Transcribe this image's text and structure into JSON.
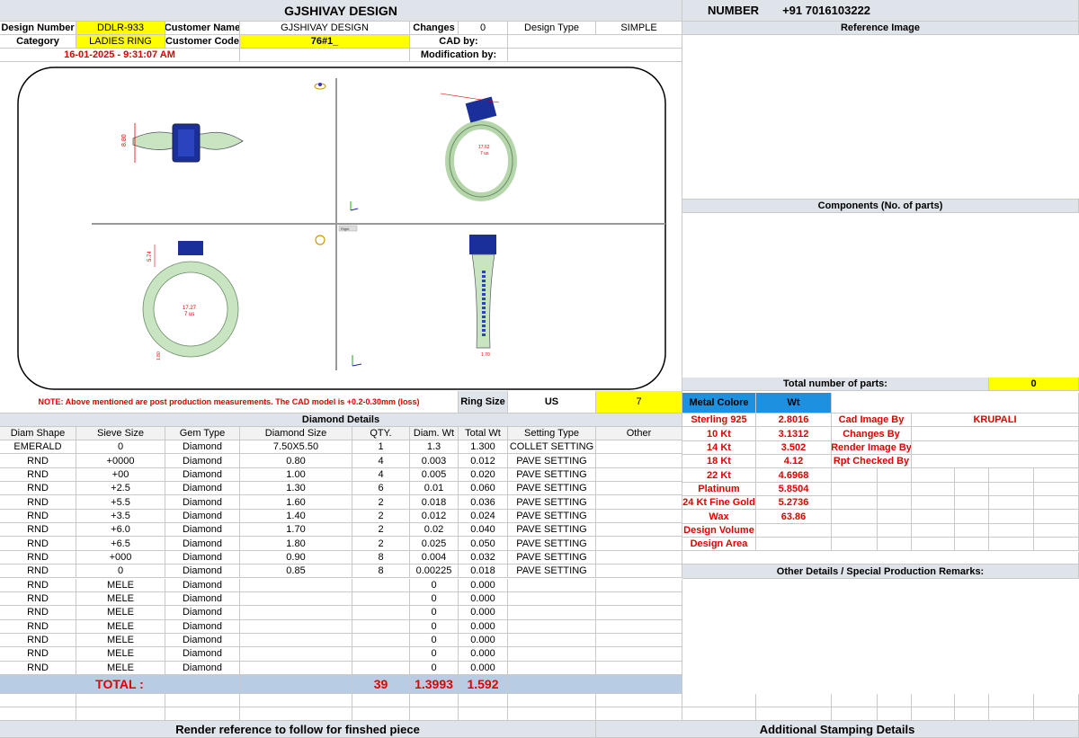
{
  "header": {
    "title": "GJSHIVAY DESIGN",
    "number_label": "NUMBER",
    "number_value": "+91 7016103222"
  },
  "info": {
    "design_number_label": "Design Number",
    "design_number": "DDLR-933",
    "customer_name_label": "Customer Name",
    "customer_name": "GJSHIVAY DESIGN",
    "changes_label": "Changes",
    "changes": "0",
    "design_type_label": "Design Type",
    "design_type": "SIMPLE",
    "category_label": "Category",
    "category": "LADIES RING",
    "customer_code_label": "Customer Code",
    "customer_code": "76#1_",
    "cad_by_label": "CAD by:",
    "timestamp": "16-01-2025 - 9:31:07 AM",
    "modification_label": "Modification by:"
  },
  "right_panel": {
    "reference_image": "Reference Image",
    "components": "Components (No. of parts)",
    "total_parts_label": "Total number of parts:",
    "total_parts": "0",
    "other_details": "Other Details / Special Production Remarks:",
    "additional_stamping": "Additional Stamping Details"
  },
  "note": {
    "text": "NOTE: Above mentioned are post production measurements. The CAD model is +0.2-0.30mm (loss)",
    "ring_size_label": "Ring Size",
    "ring_size_unit": "US",
    "ring_size": "7"
  },
  "cad_views": {
    "top_width": "8.80",
    "side_dim_a": "17.62",
    "side_dim_b": "7 us",
    "front_dim_h": "5.74",
    "front_dim_inner": "17.27",
    "front_dim_us": "7 us",
    "front_dim_band": "1.80",
    "profile_dim": "1.70",
    "view_label": "Right"
  },
  "diamond": {
    "title": "Diamond Details",
    "headers": [
      "Diam Shape",
      "Sieve Size",
      "Gem Type",
      "Diamond Size",
      "QTY.",
      "Diam. Wt",
      "Total Wt",
      "Setting Type",
      "Other"
    ],
    "rows": [
      [
        "EMERALD",
        "0",
        "Diamond",
        "7.50X5.50",
        "1",
        "1.3",
        "1.300",
        "COLLET SETTING",
        ""
      ],
      [
        "RND",
        "+0000",
        "Diamond",
        "0.80",
        "4",
        "0.003",
        "0.012",
        "PAVE SETTING",
        ""
      ],
      [
        "RND",
        "+00",
        "Diamond",
        "1.00",
        "4",
        "0.005",
        "0.020",
        "PAVE SETTING",
        ""
      ],
      [
        "RND",
        "+2.5",
        "Diamond",
        "1.30",
        "6",
        "0.01",
        "0.060",
        "PAVE SETTING",
        ""
      ],
      [
        "RND",
        "+5.5",
        "Diamond",
        "1.60",
        "2",
        "0.018",
        "0.036",
        "PAVE SETTING",
        ""
      ],
      [
        "RND",
        "+3.5",
        "Diamond",
        "1.40",
        "2",
        "0.012",
        "0.024",
        "PAVE SETTING",
        ""
      ],
      [
        "RND",
        "+6.0",
        "Diamond",
        "1.70",
        "2",
        "0.02",
        "0.040",
        "PAVE SETTING",
        ""
      ],
      [
        "RND",
        "+6.5",
        "Diamond",
        "1.80",
        "2",
        "0.025",
        "0.050",
        "PAVE SETTING",
        ""
      ],
      [
        "RND",
        "+000",
        "Diamond",
        "0.90",
        "8",
        "0.004",
        "0.032",
        "PAVE SETTING",
        ""
      ],
      [
        "RND",
        "0",
        "Diamond",
        "0.85",
        "8",
        "0.00225",
        "0.018",
        "PAVE SETTING",
        ""
      ],
      [
        "RND",
        "MELE",
        "Diamond",
        "",
        "",
        "0",
        "0.000",
        "",
        ""
      ],
      [
        "RND",
        "MELE",
        "Diamond",
        "",
        "",
        "0",
        "0.000",
        "",
        ""
      ],
      [
        "RND",
        "MELE",
        "Diamond",
        "",
        "",
        "0",
        "0.000",
        "",
        ""
      ],
      [
        "RND",
        "MELE",
        "Diamond",
        "",
        "",
        "0",
        "0.000",
        "",
        ""
      ],
      [
        "RND",
        "MELE",
        "Diamond",
        "",
        "",
        "0",
        "0.000",
        "",
        ""
      ],
      [
        "RND",
        "MELE",
        "Diamond",
        "",
        "",
        "0",
        "0.000",
        "",
        ""
      ],
      [
        "RND",
        "MELE",
        "Diamond",
        "",
        "",
        "0",
        "0.000",
        "",
        ""
      ]
    ],
    "total_label": "TOTAL :",
    "total_qty": "39",
    "total_diam_wt": "1.3993",
    "total_wt": "1.592"
  },
  "metal": {
    "header_label": "Metal Colore",
    "header_wt": "Wt",
    "rows": [
      [
        "Sterling 925",
        "2.8016"
      ],
      [
        "10 Kt",
        "3.1312"
      ],
      [
        "14 Kt",
        "3.502"
      ],
      [
        "18 Kt",
        "4.12"
      ],
      [
        "22 Kt",
        "4.6968"
      ],
      [
        "Platinum",
        "5.8504"
      ],
      [
        "24 Kt Fine Gold",
        "5.2736"
      ],
      [
        "Wax",
        "63.86"
      ],
      [
        "Design Volume",
        ""
      ],
      [
        "Design Area",
        ""
      ]
    ],
    "credits": [
      [
        "Cad Image By",
        "KRUPALI"
      ],
      [
        "Changes By",
        ""
      ],
      [
        "Render Image By",
        ""
      ],
      [
        "Rpt Checked By",
        ""
      ]
    ]
  },
  "footer": {
    "render_reference": "Render reference to follow for finshed piece"
  },
  "colors": {
    "yellow": "#ffff00",
    "blue": "#1e90e0",
    "red": "#e00000",
    "header_gray": "#dfe3ea",
    "total_row": "#b8cce4",
    "ring_metal": "#c9e4c0",
    "gem_blue": "#1a2f9a"
  }
}
